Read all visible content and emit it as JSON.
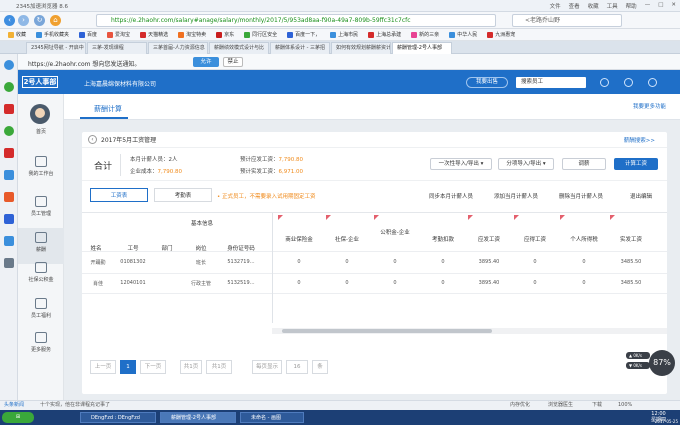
{
  "browser": {
    "title": "2345加速浏览器 8.6",
    "window_menu": [
      "文件",
      "查看",
      "收藏",
      "工具",
      "帮助"
    ],
    "url": "https://e.2haohr.com/salary#anage/salary/monthly/2017/5/953ad8aa-f90a-49a7-809b-59ffc31c7cfc",
    "search_placeholder": "<老路乔山野",
    "favorites": [
      "收藏",
      "手机收藏夹",
      "百度",
      "爱淘宝",
      "天猫精选",
      "淘宝特卖",
      "京东",
      "同行区安全",
      "百度一下，",
      "上海市民",
      "上海总承建",
      "新的三亲",
      "中华人民",
      "九洲惠宠"
    ],
    "tabs": [
      "2345网址导航 - 开启中",
      "三茅-发现课程",
      "三茅首届-人力资源信息",
      "薪酬绩效模式设计与比",
      "薪酬体系设计 - 三茅招",
      "如何有效规划薪酬薪资计",
      "薪酬管理-2号人事部"
    ],
    "active_tab": 6,
    "notify_text": "https://e.2haohr.com 想向您发送通知。",
    "notify_allow": "允许",
    "notify_block": "禁止"
  },
  "app": {
    "logo": "2号人事部",
    "company": "上海嘉晨绵保材料有限公司",
    "header_button": "我要出售",
    "header_search": "搜索员工",
    "nav": [
      {
        "label": "首页"
      },
      {
        "label": "我的工作台"
      },
      {
        "label": "员工管理"
      },
      {
        "label": "薪酬"
      },
      {
        "label": "社保公积金"
      },
      {
        "label": "员工福利"
      },
      {
        "label": "更多服务"
      }
    ],
    "active_nav": 3,
    "subtab": "薪酬计算",
    "feedback": "我要更多功能"
  },
  "payroll": {
    "title": "2017年5月工资管理",
    "help": "薪酬搜索>>",
    "sum_title": "合计",
    "headcount_label": "本月计薪人员：",
    "headcount": "2人",
    "company_cost_label": "企业成本：",
    "company_cost": "7,790.80",
    "gross_label": "预计应发工资：",
    "gross": "7,790.80",
    "net_label": "预计实发工资：",
    "net": "6,971.00",
    "btn_import": "一次性导入/导出",
    "btn_export": "分项导入/导出",
    "btn_adjust": "调薪",
    "btn_calc": "计算工资",
    "seg_salary": "工资表",
    "seg_attendance": "考勤表",
    "warning": "• 正式员工，不需要录入试用期固定工资",
    "actions": [
      "同步本月计薪人员",
      "添加当月计薪人员",
      "删除当月计薪人员",
      "退出编辑"
    ]
  },
  "table": {
    "group_basic": "基本信息",
    "headers": [
      "姓名",
      "工号",
      "部门",
      "岗位",
      "身份证号码",
      "商业保险金",
      "社保-企业",
      "公积金-企业",
      "考勤扣款",
      "应发工资",
      "应得工资",
      "个人所得税",
      "实发工资"
    ],
    "rows": [
      [
        "开踊勤",
        "01081302",
        "",
        "班长",
        "5132719…",
        "0",
        "0",
        "0",
        "0",
        "3895.40",
        "0",
        "0",
        "3485.50"
      ],
      [
        "肖佳",
        "12040101",
        "",
        "行政主管",
        "5132519…",
        "0",
        "0",
        "0",
        "0",
        "3895.40",
        "0",
        "0",
        "3485.50"
      ]
    ]
  },
  "pagination": {
    "prev": "上一页",
    "current": "1",
    "next": "下一页",
    "total_pages": "共1页",
    "page_count": "共1页",
    "per_page_label": "每页显示",
    "per_page": "16",
    "unit": "条"
  },
  "gauge": {
    "value": "87%",
    "up": "0K/s",
    "down": "0K/s"
  },
  "statusbar": {
    "left": "头条新闻",
    "news": "十个实现，他在非课程充记事了",
    "right": [
      "内存优化",
      "浏览器医生",
      "下载",
      "100%"
    ]
  },
  "taskbar": {
    "tasks": [
      "DEngFzd : DEngFzd",
      "薪酬管理-2号人事部",
      "未命名 - 画图"
    ],
    "time": "12:00",
    "weekday": "星期四",
    "date": "2017-05-25"
  }
}
